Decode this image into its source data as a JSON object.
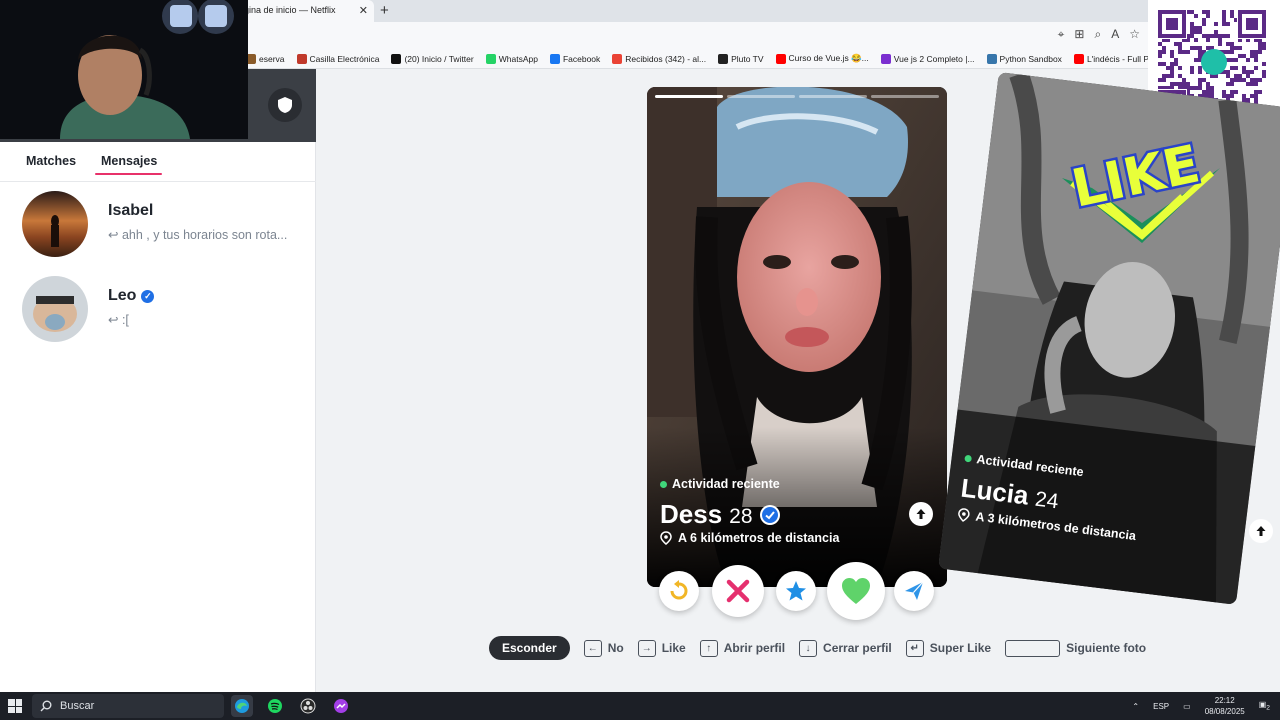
{
  "browser": {
    "tab_title": "gina de inicio — Netflix",
    "tab_close": "✕",
    "new_tab": "+"
  },
  "bookmarks": [
    {
      "label": "eserva",
      "color": "#8a5b2a"
    },
    {
      "label": "Casilla Electrónica",
      "color": "#c0392b"
    },
    {
      "label": "(20) Inicio / Twitter",
      "color": "#111111"
    },
    {
      "label": "WhatsApp",
      "color": "#25d366"
    },
    {
      "label": "Facebook",
      "color": "#1877f2"
    },
    {
      "label": "Recibidos (342) - al...",
      "color": "#ea4335"
    },
    {
      "label": "Pluto TV",
      "color": "#222222"
    },
    {
      "label": "Curso de Vue.js 😂...",
      "color": "#ff0000"
    },
    {
      "label": "Vue js 2 Completo |...",
      "color": "#7b2fd0"
    },
    {
      "label": "Python Sandbox",
      "color": "#3776ab"
    },
    {
      "label": "L'indécis - Full Perfo...",
      "color": "#ff0000"
    }
  ],
  "sidebar": {
    "tabs": {
      "matches": "Matches",
      "mensajes": "Mensajes"
    },
    "messages": [
      {
        "name": "Isabel",
        "preview": "↩ ahh , y tus horarios son rota...",
        "verified": false
      },
      {
        "name": "Leo",
        "preview": "↩ :[",
        "verified": true
      }
    ]
  },
  "card": {
    "activity": "Actividad reciente",
    "name": "Dess",
    "age": "28",
    "distance": "A 6 kilómetros de distancia",
    "photos_total": 4,
    "photo_current": 1
  },
  "card2": {
    "sticker": "LIKE",
    "activity": "Actividad reciente",
    "name": "Lucia",
    "age": "24",
    "distance": "A 3 kilómetros de distancia"
  },
  "hints": {
    "hide": "Esconder",
    "no": "No",
    "like": "Like",
    "open": "Abrir perfil",
    "close": "Cerrar perfil",
    "super": "Super Like",
    "next": "Siguiente foto"
  },
  "taskbar": {
    "search": "Buscar",
    "lang": "ESP",
    "time": "22:12",
    "date": "08/08/2025",
    "notif": "2"
  },
  "colors": {
    "accent": "#e8316a",
    "nope": "#e5306e",
    "like": "#5fd36a",
    "super": "#1f8fe5",
    "rewind": "#f1b626",
    "boost": "#2f95e8"
  }
}
